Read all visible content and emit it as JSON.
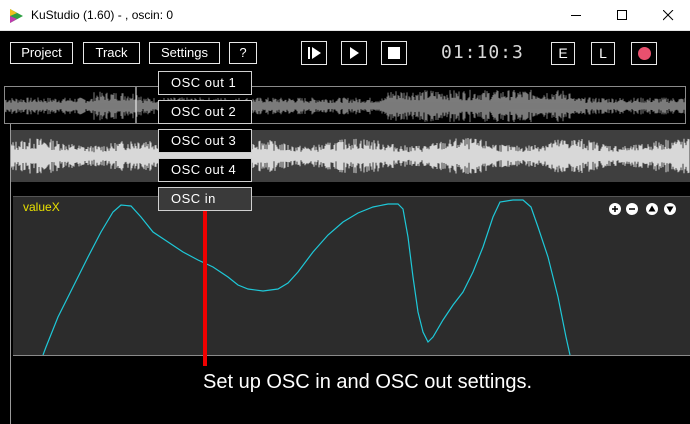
{
  "window": {
    "title": "KuStudio (1.60) - , oscin: 0",
    "minimize_icon": "minimize-icon",
    "maximize_icon": "maximize-icon",
    "close_icon": "close-icon"
  },
  "menu": {
    "project": "Project",
    "track": "Track",
    "settings": "Settings",
    "help": "?"
  },
  "transport": {
    "play_from_start_icon": "play-from-start-icon",
    "play_icon": "play-icon",
    "stop_icon": "stop-icon",
    "time": "01:10:3"
  },
  "modes": {
    "edit": "E",
    "loop": "L",
    "record_icon": "record-icon"
  },
  "settings_menu": {
    "items": [
      {
        "label": "OSC  out  1"
      },
      {
        "label": "OSC  out  2"
      },
      {
        "label": "OSC  out  3"
      },
      {
        "label": "OSC  out  4"
      },
      {
        "label": "OSC  in"
      }
    ]
  },
  "graph": {
    "label": "valueX",
    "zoom_icons": [
      "zoom-in-icon",
      "zoom-out-icon",
      "scroll-up-icon",
      "scroll-down-icon"
    ]
  },
  "caption": "Set up OSC in and OSC out settings.",
  "colors": {
    "curve": "#1ec8d8",
    "label": "#e8e000",
    "cursor": "#f00000",
    "record": "#e8506e"
  }
}
